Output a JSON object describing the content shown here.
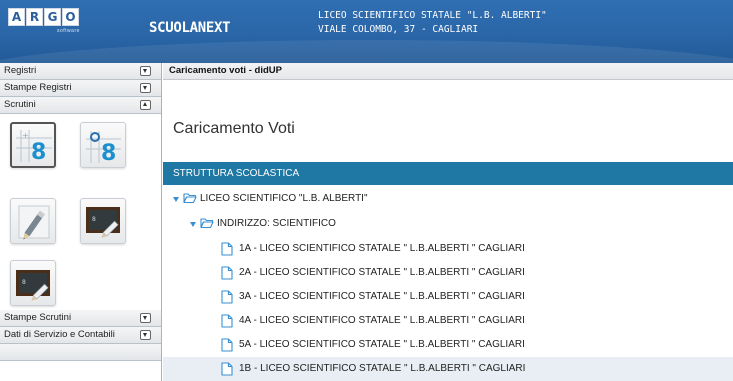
{
  "header": {
    "logo_letters": [
      "A",
      "R",
      "G",
      "O"
    ],
    "logo_sub": "software",
    "app_name": "SCUOLANEXT",
    "school_line1": "LICEO SCIENTIFICO STATALE \"L.B. ALBERTI\"",
    "school_line2": "VIALE COLOMBO, 37 - CAGLIARI",
    "colors": {
      "header_bg": "#2a66a8",
      "section_bar": "#1f78a4",
      "tree_icon": "#3a8fd0"
    }
  },
  "sidebar": {
    "sections": [
      {
        "label": "Registri",
        "state": "collapsed"
      },
      {
        "label": "Stampe Registri",
        "state": "collapsed"
      },
      {
        "label": "Scrutini",
        "state": "expanded"
      },
      {
        "label": "Stampe Scrutini",
        "state": "collapsed"
      },
      {
        "label": "Dati di Servizio e Contabili",
        "state": "collapsed"
      }
    ],
    "scrutini_buttons": [
      {
        "name": "voti-proposti-icon",
        "active": true
      },
      {
        "name": "voti-finali-icon",
        "active": false
      },
      {
        "name": "giudizi-icon",
        "active": false
      },
      {
        "name": "tabellone-icon",
        "active": false
      },
      {
        "name": "registro-icon",
        "active": false
      }
    ]
  },
  "main": {
    "breadcrumb": "Caricamento voti - didUP",
    "page_title": "Caricamento Voti",
    "section_title": "STRUTTURA SCOLASTICA",
    "tree": {
      "root": "LICEO SCIENTIFICO \"L.B. ALBERTI\"",
      "branch": "INDIRIZZO: SCIENTIFICO",
      "classes": [
        "1A - LICEO SCIENTIFICO STATALE \" L.B.ALBERTI \" CAGLIARI",
        "2A - LICEO SCIENTIFICO STATALE \" L.B.ALBERTI \" CAGLIARI",
        "3A - LICEO SCIENTIFICO STATALE \" L.B.ALBERTI \" CAGLIARI",
        "4A - LICEO SCIENTIFICO STATALE \" L.B.ALBERTI \" CAGLIARI",
        "5A - LICEO SCIENTIFICO STATALE \" L.B.ALBERTI \" CAGLIARI",
        "1B - LICEO SCIENTIFICO STATALE \" L.B.ALBERTI \" CAGLIARI"
      ],
      "selected_index": 5
    }
  }
}
